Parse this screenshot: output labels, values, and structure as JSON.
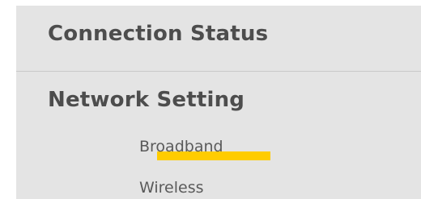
{
  "menu": {
    "connection_status": "Connection Status",
    "network_setting": "Network Setting",
    "sub_items": {
      "broadband": "Broadband",
      "wireless": "Wireless"
    }
  },
  "colors": {
    "panel_background": "#e4e4e4",
    "heading_text": "#4d4d4d",
    "sub_item_text": "#5a5a5a",
    "active_highlight": "#ffcc00",
    "divider": "#c9c9c9"
  },
  "state": {
    "active_sub_item": "broadband"
  }
}
